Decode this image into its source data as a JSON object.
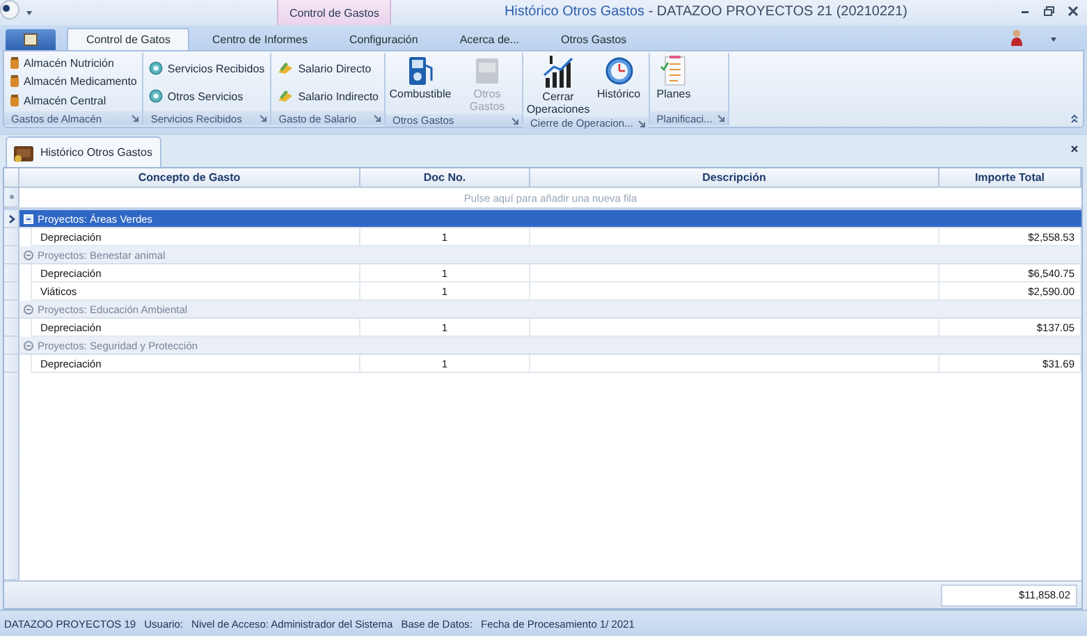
{
  "window": {
    "document_title": "Histórico Otros Gastos",
    "app_title": "- DATAZOO PROYECTOS 21 (20210221)",
    "context_tab": "Control de Gastos"
  },
  "ribbon": {
    "tabs": [
      {
        "label": "Control de Gatos",
        "selected": true
      },
      {
        "label": "Centro de Informes",
        "selected": false
      },
      {
        "label": "Configuración",
        "selected": false
      },
      {
        "label": "Acerca de...",
        "selected": false
      },
      {
        "label": "Otros Gastos",
        "selected": false
      }
    ],
    "groups": [
      {
        "caption": "Gastos de Almacén",
        "items": [
          {
            "kind": "small",
            "label": "Almacén Nutrición",
            "disabled": false
          },
          {
            "kind": "small",
            "label": "Almacén Medicamento",
            "disabled": false
          },
          {
            "kind": "small",
            "label": "Almacén Central",
            "disabled": false
          }
        ]
      },
      {
        "caption": "Servicios Recibidos",
        "items": [
          {
            "kind": "small",
            "label": "Servicios Recibidos",
            "disabled": false
          },
          {
            "kind": "small",
            "label": "Otros Servicios",
            "disabled": false
          }
        ]
      },
      {
        "caption": "Gasto de Salario",
        "items": [
          {
            "kind": "small",
            "label": "Salario Directo",
            "disabled": false
          },
          {
            "kind": "small",
            "label": "Salario Indirecto",
            "disabled": false
          }
        ]
      },
      {
        "caption": "Otros Gastos",
        "items": [
          {
            "kind": "large",
            "label": "Combustible",
            "disabled": false
          },
          {
            "kind": "large",
            "label": "Otros Gastos",
            "disabled": true
          }
        ]
      },
      {
        "caption": "Cierre de Operacion...",
        "items": [
          {
            "kind": "large",
            "label": "Cerrar Operaciones",
            "disabled": false
          },
          {
            "kind": "large",
            "label": "Histórico",
            "disabled": false
          }
        ]
      },
      {
        "caption": "Planificaci...",
        "items": [
          {
            "kind": "large",
            "label": "Planes",
            "disabled": false
          }
        ]
      }
    ]
  },
  "document_tab": {
    "label": "Histórico Otros Gastos"
  },
  "table": {
    "columns": [
      "Concepto de Gasto",
      "Doc No.",
      "Descripción",
      "Importe Total"
    ],
    "new_row_hint": "Pulse aquí para añadir una nueva fila",
    "groups": [
      {
        "label": "Proyectos: Áreas Verdes",
        "selected": true,
        "expanded": true,
        "rows": [
          [
            "Depreciación",
            "1",
            "",
            "$2,558.53"
          ]
        ]
      },
      {
        "label": "Proyectos: Benestar animal",
        "selected": false,
        "expanded": true,
        "rows": [
          [
            "Depreciación",
            "1",
            "",
            "$6,540.75"
          ],
          [
            "Viáticos",
            "1",
            "",
            "$2,590.00"
          ]
        ]
      },
      {
        "label": "Proyectos: Educación Ambiental",
        "selected": false,
        "expanded": true,
        "rows": [
          [
            "Depreciación",
            "1",
            "",
            "$137.05"
          ]
        ]
      },
      {
        "label": "Proyectos: Seguridad y Protección",
        "selected": false,
        "expanded": true,
        "rows": [
          [
            "Depreciación",
            "1",
            "",
            "$31.69"
          ]
        ]
      }
    ],
    "total": "$11,858.02"
  },
  "status_bar": [
    "DATAZOO PROYECTOS 19",
    "Usuario:",
    "Nivel de Acceso: Administrador del Sistema",
    "Base de Datos:",
    "Fecha de Procesamiento 1/ 2021"
  ]
}
